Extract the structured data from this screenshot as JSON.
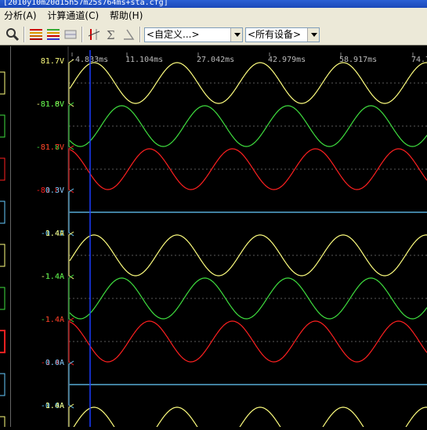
{
  "window": {
    "title": "[2010y10m20d15h57m25s764ms+sta.cfg]"
  },
  "menu": [
    {
      "label": "分析(A)"
    },
    {
      "label": "计算通道(C)"
    },
    {
      "label": "帮助(H)"
    }
  ],
  "toolbar": {
    "combo1": "<自定义...>",
    "combo2": "<所有设备>",
    "icons": [
      "zoom-icon",
      "channel-colors-icon",
      "channel-colors-alt-icon",
      "grid-icon",
      "cursor-icon",
      "sum-icon",
      "angle-icon"
    ]
  },
  "time_axis": {
    "ticks": [
      "-4.833ms",
      "11.104ms",
      "27.042ms",
      "42.979ms",
      "58.917ms",
      "74.7"
    ]
  },
  "colors": {
    "yellow": "#ffff7f",
    "green": "#3fdf3f",
    "red": "#ff2020",
    "cyan": "#66ccff",
    "cursor": "#1a3cff"
  },
  "channels": [
    {
      "max": "81.7V",
      "min": "-81.8V",
      "color": "#ffff7f",
      "type": "sine",
      "phase": 0
    },
    {
      "max": "81.6V",
      "min": "-81.8V",
      "color": "#3fdf3f",
      "type": "sine",
      "phase": 120
    },
    {
      "max": "81.7V",
      "min": "-81.8V",
      "color": "#ff2020",
      "type": "sine",
      "phase": 240
    },
    {
      "max": "0.3V",
      "min": "-0.4V",
      "color": "#66ccff",
      "type": "flat",
      "phase": 0
    },
    {
      "max": "1.4A",
      "min": "-1.4A",
      "color": "#ffff7f",
      "type": "sine",
      "phase": 0
    },
    {
      "max": "1.4A",
      "min": "-1.4A",
      "color": "#3fdf3f",
      "type": "sine",
      "phase": 120
    },
    {
      "max": "1.4A",
      "min": "-1.4A",
      "color": "#ff2020",
      "type": "sine",
      "phase": 240
    },
    {
      "max": "0.0A",
      "min": "-0.0A",
      "color": "#66ccff",
      "type": "flat",
      "phase": 0
    },
    {
      "max": "1.4A",
      "min": "",
      "color": "#ffff7f",
      "type": "sine",
      "phase": 0
    }
  ]
}
